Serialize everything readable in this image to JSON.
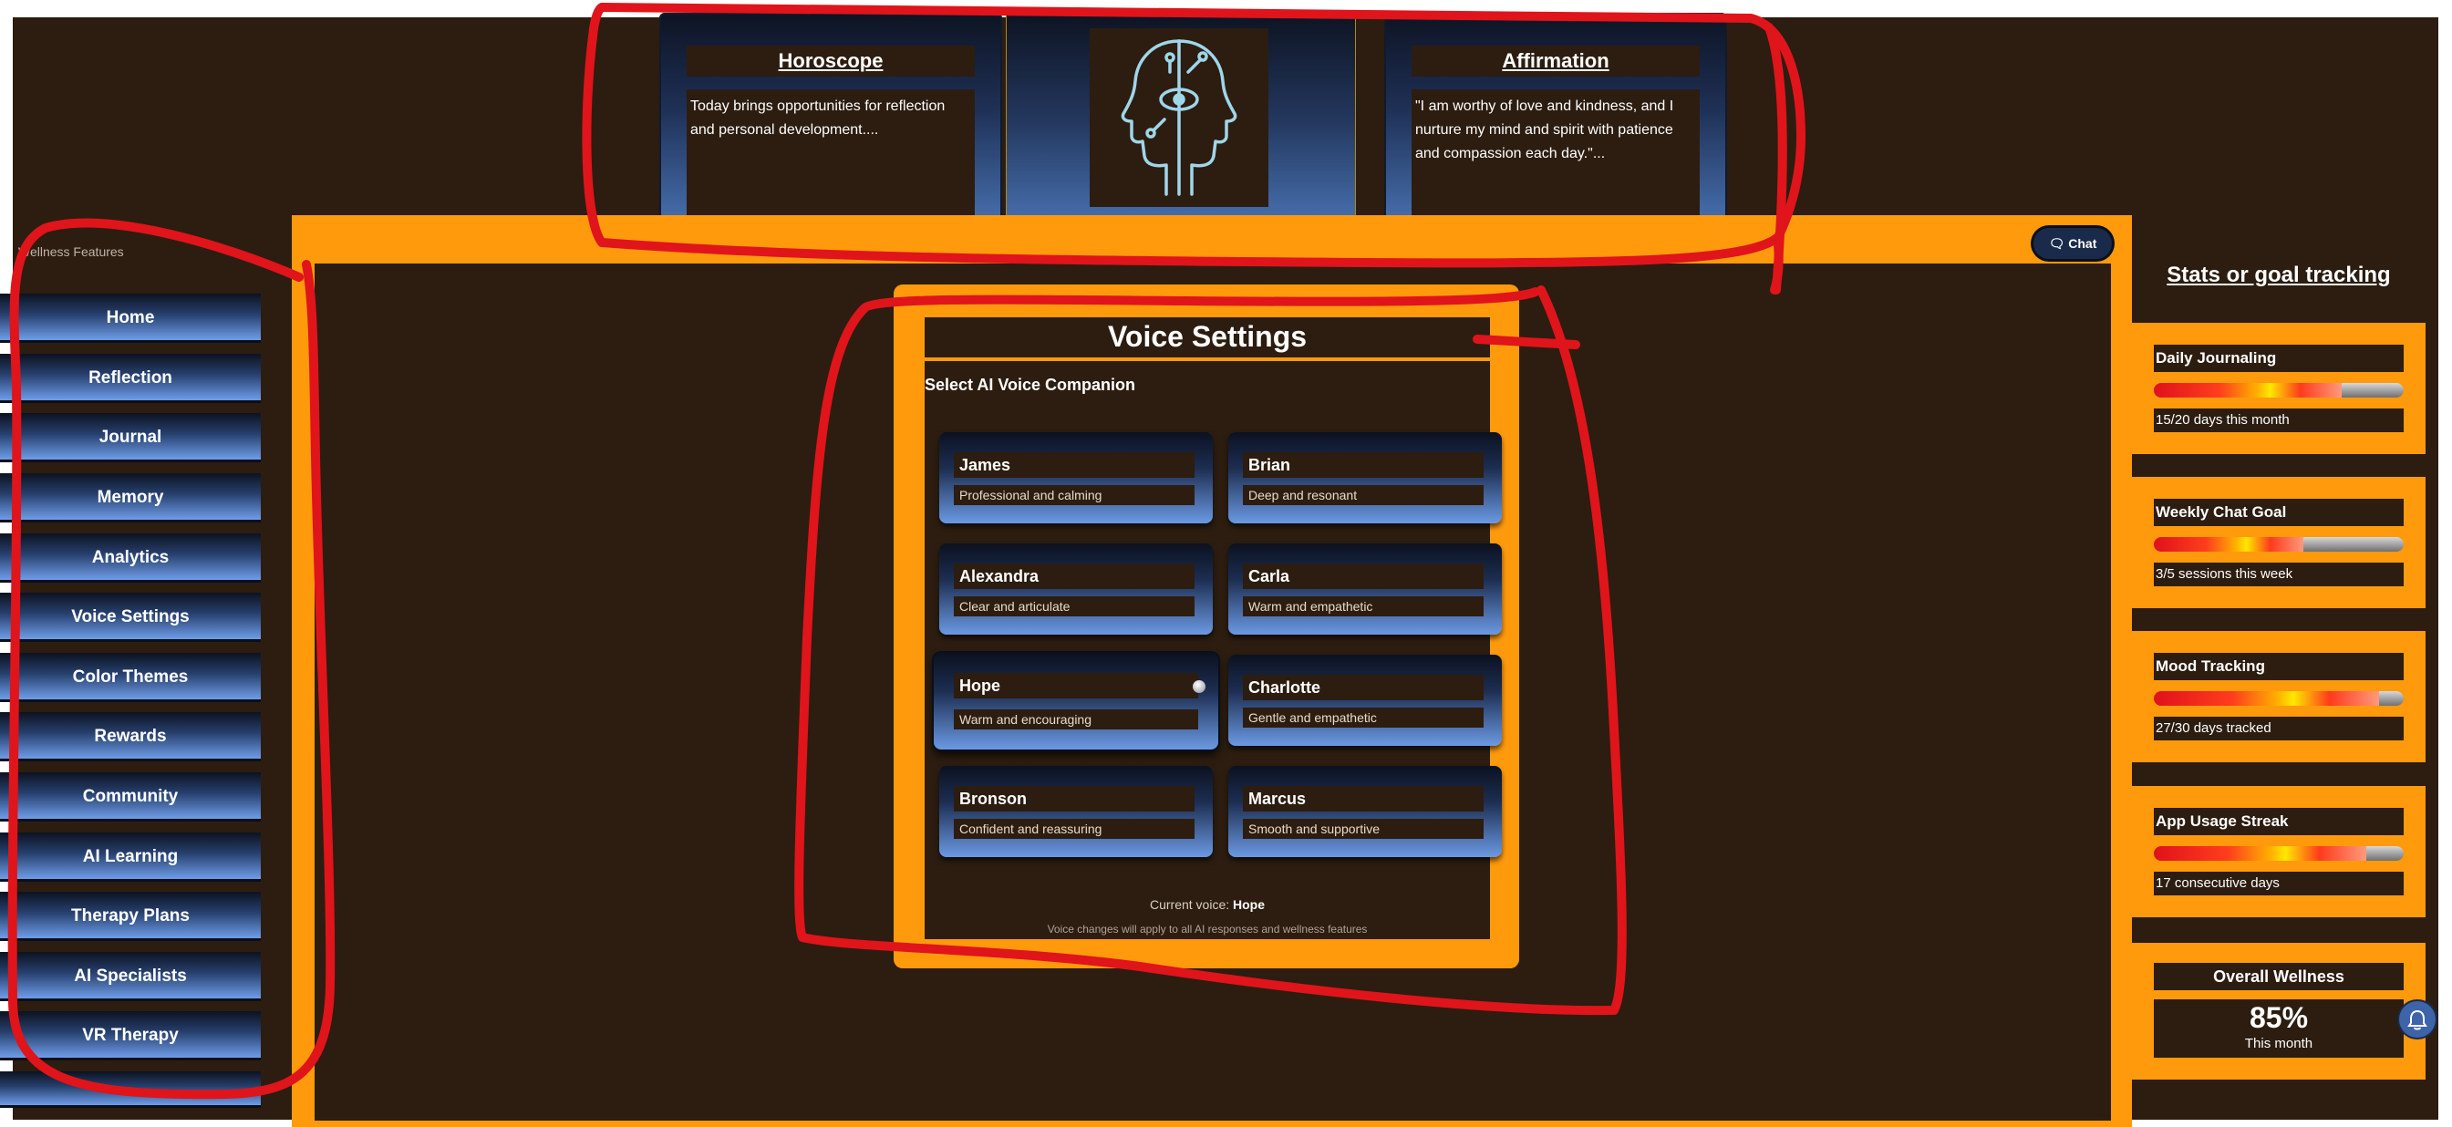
{
  "top": {
    "horoscope": {
      "title": "Horoscope",
      "text": "Today brings opportunities for reflection and personal development...."
    },
    "affirmation": {
      "title": "Affirmation",
      "text": "\"I am worthy of love and kindness, and I nurture my mind and spirit with patience and compassion each day.\"..."
    },
    "logo_icon": "twin-faces-eye-logo-icon"
  },
  "sidebar": {
    "label": "Wellness Features",
    "items": [
      {
        "label": "Home"
      },
      {
        "label": "Reflection"
      },
      {
        "label": "Journal"
      },
      {
        "label": "Memory"
      },
      {
        "label": "Analytics"
      },
      {
        "label": "Voice Settings"
      },
      {
        "label": "Color Themes"
      },
      {
        "label": "Rewards"
      },
      {
        "label": "Community"
      },
      {
        "label": "AI Learning"
      },
      {
        "label": "Therapy Plans"
      },
      {
        "label": "AI Specialists"
      },
      {
        "label": "VR Therapy"
      }
    ]
  },
  "chat": {
    "label": "Chat",
    "icon": "chat-bubble-icon"
  },
  "voice_settings": {
    "title": "Voice Settings",
    "subtitle": "Select AI Voice Companion",
    "voices": [
      {
        "name": "James",
        "desc": "Professional and calming"
      },
      {
        "name": "Brian",
        "desc": "Deep and resonant"
      },
      {
        "name": "Alexandra",
        "desc": "Clear and articulate"
      },
      {
        "name": "Carla",
        "desc": "Warm and empathetic"
      },
      {
        "name": "Hope",
        "desc": "Warm and encouraging",
        "selected": true
      },
      {
        "name": "Charlotte",
        "desc": "Gentle and empathetic"
      },
      {
        "name": "Bronson",
        "desc": "Confident and reassuring"
      },
      {
        "name": "Marcus",
        "desc": "Smooth and supportive"
      }
    ],
    "current_label": "Current voice:",
    "current_value": "Hope",
    "note": "Voice changes will apply to all AI responses and wellness features"
  },
  "stats": {
    "title": "Stats or goal tracking",
    "items": [
      {
        "label": "Daily Journaling",
        "value": "15/20 days this month",
        "progress": 0.75
      },
      {
        "label": "Weekly Chat Goal",
        "value": "3/5 sessions this week",
        "progress": 0.6
      },
      {
        "label": "Mood Tracking",
        "value": "27/30 days tracked",
        "progress": 0.9
      },
      {
        "label": "App Usage Streak",
        "value": "17 consecutive days",
        "progress": 0.85
      }
    ],
    "overall": {
      "label": "Overall Wellness",
      "value": "85%",
      "sub": "This month"
    }
  },
  "notification_icon": "bell-icon",
  "colors": {
    "background": "#2c1d10",
    "accent": "#ff9a0d",
    "button_gradient_top": "#0c1220",
    "button_gradient_bottom": "#6f9de8",
    "annotation": "#e0141b"
  }
}
